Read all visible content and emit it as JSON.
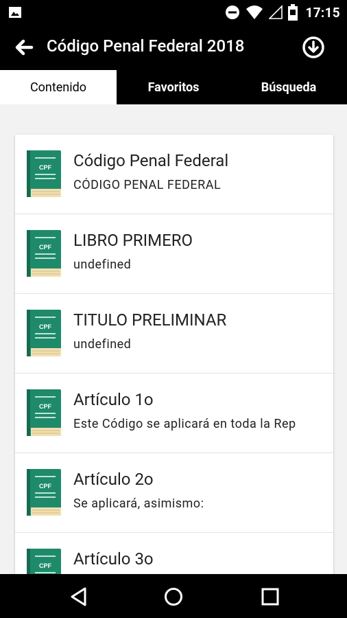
{
  "status_bar": {
    "time": "17:15",
    "icons": [
      "image-icon",
      "do-not-disturb-icon",
      "wifi-icon",
      "signal-icon",
      "battery-icon"
    ]
  },
  "app_bar": {
    "title": "Código Penal Federal 2018",
    "back_icon": "arrow-back-icon",
    "download_icon": "download-circle-icon"
  },
  "tabs": [
    {
      "label": "Contenido",
      "active": true
    },
    {
      "label": "Favoritos",
      "active": false
    },
    {
      "label": "Búsqueda",
      "active": false
    }
  ],
  "book_icon": {
    "label": "CPF",
    "color": "#1e8a6a"
  },
  "items": [
    {
      "title": "Código Penal Federal",
      "subtitle": "CÓDIGO PENAL FEDERAL"
    },
    {
      "title": "LIBRO PRIMERO",
      "subtitle": "undefined"
    },
    {
      "title": "TITULO PRELIMINAR",
      "subtitle": "undefined"
    },
    {
      "title": "Artículo 1o",
      "subtitle": "Este Código se aplicará en toda la Rep"
    },
    {
      "title": "Artículo 2o",
      "subtitle": "Se aplicará, asimismo:"
    },
    {
      "title": "Artículo 3o",
      "subtitle": ""
    }
  ],
  "nav_bar": {
    "icons": [
      "back-triangle-icon",
      "home-circle-icon",
      "recents-square-icon"
    ]
  }
}
